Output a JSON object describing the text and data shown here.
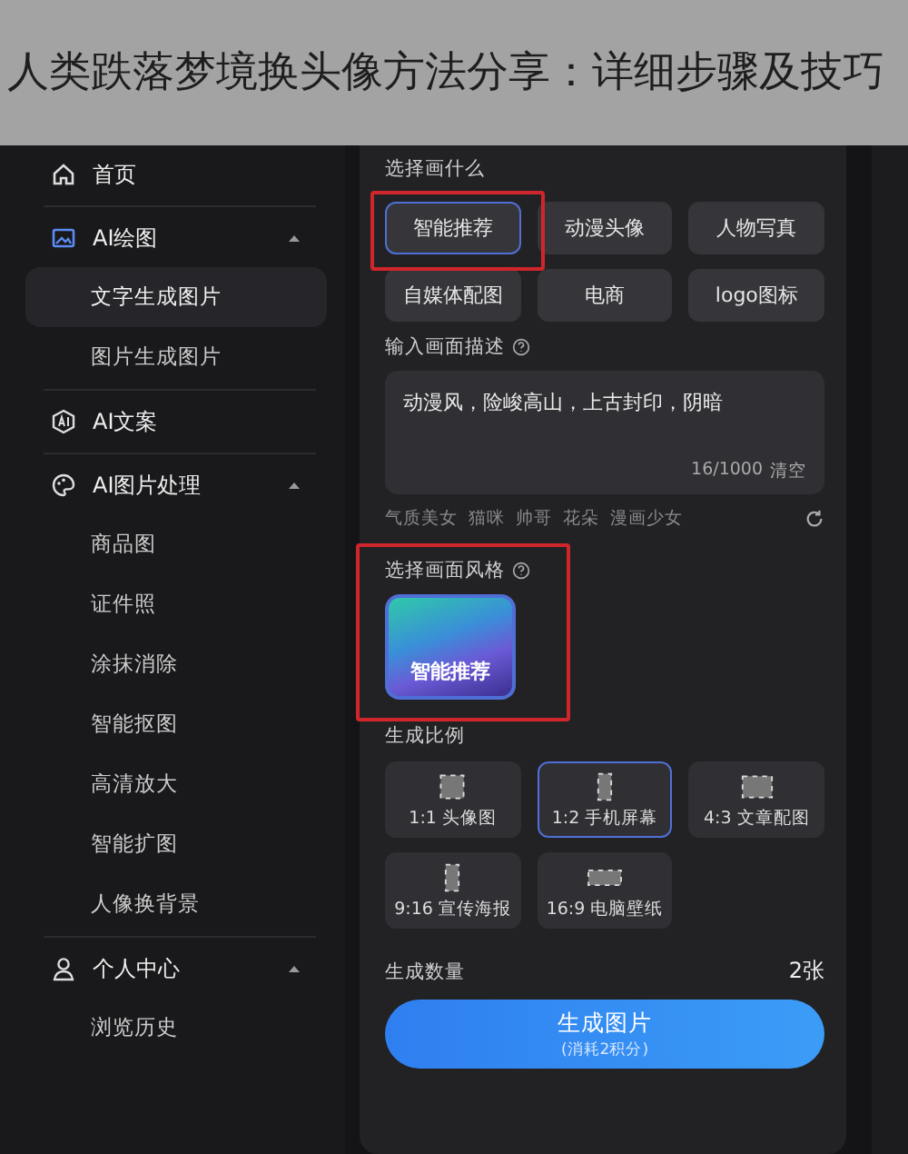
{
  "article_title": "人类跌落梦境换头像方法分享：详细步骤及技巧",
  "sidebar": {
    "items": [
      {
        "label": "首页",
        "kind": "home"
      },
      {
        "label": "AI绘图",
        "kind": "picture",
        "expanded": true,
        "children": [
          {
            "label": "文字生成图片",
            "selected": true
          },
          {
            "label": "图片生成图片",
            "selected": false
          }
        ]
      },
      {
        "label": "AI文案",
        "kind": "ai"
      },
      {
        "label": "AI图片处理",
        "kind": "palette",
        "expanded": true,
        "children": [
          {
            "label": "商品图",
            "selected": false
          },
          {
            "label": "证件照",
            "selected": false
          },
          {
            "label": "涂抹消除",
            "selected": false
          },
          {
            "label": "智能抠图",
            "selected": false
          },
          {
            "label": "高清放大",
            "selected": false
          },
          {
            "label": "智能扩图",
            "selected": false
          },
          {
            "label": "人像换背景",
            "selected": false
          }
        ]
      },
      {
        "label": "个人中心",
        "kind": "user",
        "expanded": true,
        "children": [
          {
            "label": "浏览历史",
            "selected": false
          }
        ]
      }
    ]
  },
  "panel": {
    "category_label": "选择画什么",
    "categories": [
      {
        "label": "智能推荐",
        "selected": true
      },
      {
        "label": "动漫头像",
        "selected": false
      },
      {
        "label": "人物写真",
        "selected": false
      },
      {
        "label": "自媒体配图",
        "selected": false
      },
      {
        "label": "电商",
        "selected": false
      },
      {
        "label": "logo图标",
        "selected": false
      }
    ],
    "description_label": "输入画面描述",
    "description": {
      "value": "动漫风，险峻高山，上古封印，阴暗",
      "counter": "16/1000",
      "clear": "清空"
    },
    "suggestions": [
      "气质美女",
      "猫咪",
      "帅哥",
      "花朵",
      "漫画少女"
    ],
    "style_label": "选择画面风格",
    "styles": [
      {
        "label": "智能推荐",
        "selected": true
      }
    ],
    "ratio_label": "生成比例",
    "ratios": [
      {
        "label": "1:1 头像图",
        "kind": "square",
        "selected": false
      },
      {
        "label": "1:2 手机屏幕",
        "kind": "tall",
        "selected": true
      },
      {
        "label": "4:3 文章配图",
        "kind": "wide",
        "selected": false
      },
      {
        "label": "9:16 宣传海报",
        "kind": "tall",
        "selected": false
      },
      {
        "label": "16:9 电脑壁纸",
        "kind": "banner",
        "selected": false
      }
    ],
    "count_label": "生成数量",
    "count": "2张",
    "generate": {
      "label": "生成图片",
      "note": "(消耗2积分)"
    }
  }
}
